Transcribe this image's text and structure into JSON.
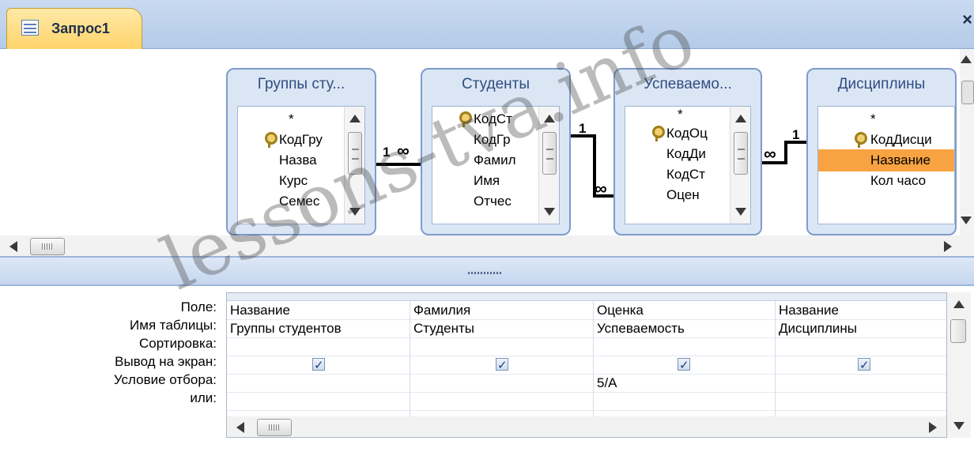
{
  "tab": {
    "title": "Запрос1",
    "close": "×"
  },
  "tables": [
    {
      "title": "Группы сту...",
      "fields": [
        "*",
        "КодГру",
        "Назва",
        "Курс",
        "Семес"
      ]
    },
    {
      "title": "Студенты",
      "fields": [
        "КодСт",
        "КодГр",
        "Фамил",
        "Имя",
        "Отчес"
      ]
    },
    {
      "title": "Успеваемо...",
      "fields": [
        "*",
        "КодОц",
        "КодДи",
        "КодСт",
        "Оцен"
      ]
    },
    {
      "title": "Дисциплины",
      "fields": [
        "*",
        "КодДисци",
        "Название",
        "Кол часо"
      ]
    }
  ],
  "relations": {
    "one": "1",
    "many": "∞"
  },
  "grid": {
    "row_labels": [
      "Поле:",
      "Имя таблицы:",
      "Сортировка:",
      "Вывод на экран:",
      "Условие отбора:",
      "или:"
    ],
    "columns": [
      {
        "field": "Название",
        "table": "Группы студентов",
        "sort": "",
        "show": true,
        "criteria": "",
        "or": ""
      },
      {
        "field": "Фамилия",
        "table": "Студенты",
        "sort": "",
        "show": true,
        "criteria": "",
        "or": ""
      },
      {
        "field": "Оценка",
        "table": "Успеваемость",
        "sort": "",
        "show": true,
        "criteria": "5/А",
        "or": ""
      },
      {
        "field": "Название",
        "table": "Дисциплины",
        "sort": "",
        "show": true,
        "criteria": "",
        "or": ""
      }
    ]
  },
  "watermark": "lessons-tva.info",
  "icons": [
    "query-icon",
    "primary-key-icon",
    "scroll-up-icon",
    "scroll-down-icon",
    "scroll-left-icon",
    "scroll-right-icon",
    "checkbox-checked-icon"
  ]
}
